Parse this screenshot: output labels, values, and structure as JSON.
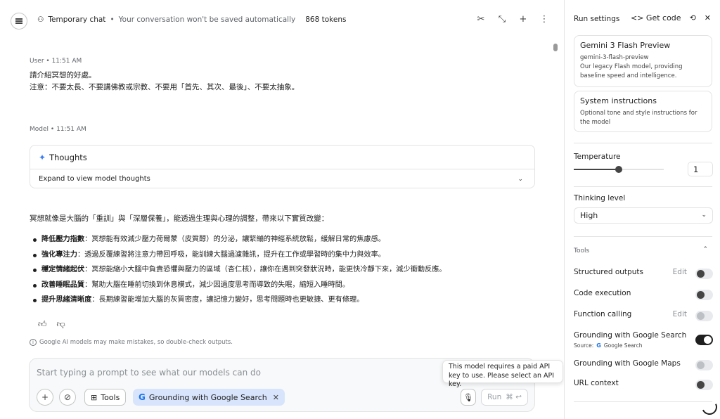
{
  "header": {
    "title": "Temporary chat",
    "subtitle": "Your conversation won't be saved automatically",
    "tokens": "868 tokens"
  },
  "user_msg": {
    "role": "User",
    "time": "11:51 AM",
    "line1": "請介紹冥想的好處。",
    "line2": "注意：不要太長、不要講佛教或宗教、不要用「首先、其次、最後」、不要太抽象。"
  },
  "model_msg": {
    "role": "Model",
    "time": "11:51 AM",
    "thoughts_title": "Thoughts",
    "thoughts_expand": "Expand to view model thoughts",
    "intro": "冥想就像是大腦的「重訓」與「深層保養」，能透過生理與心理的調整，帶來以下實質改變：",
    "items": [
      {
        "bold": "降低壓力指數",
        "text": "：冥想能有效減少壓力荷爾蒙（皮質醇）的分泌，讓緊繃的神經系統放鬆，緩解日常的焦慮感。"
      },
      {
        "bold": "強化專注力",
        "text": "：透過反覆練習將注意力帶回呼吸，能訓練大腦過濾雜訊，提升在工作或學習時的集中力與效率。"
      },
      {
        "bold": "穩定情緒起伏",
        "text": "：冥想能縮小大腦中負責恐懼與壓力的區域（杏仁核），讓你在遇到突發狀況時，能更快冷靜下來，減少衝動反應。"
      },
      {
        "bold": "改善睡眠品質",
        "text": "：幫助大腦在睡前切換到休息模式，減少因過度思考而導致的失眠，縮短入睡時間。"
      },
      {
        "bold": "提升思緒清晰度",
        "text": "：長期練習能增加大腦的灰質密度，讓記憶力變好，思考問題時也更敏捷、更有條理。"
      }
    ]
  },
  "disclaimer": "Google AI models may make mistakes, so double-check outputs.",
  "prompt": {
    "placeholder": "Start typing a prompt to see what our models can do",
    "tools_label": "Tools",
    "grounding_chip": "Grounding with Google Search",
    "run_label": "Run",
    "run_shortcut": "⌘ ↩"
  },
  "tooltip": "This model requires a paid API key to use. Please select an API key.",
  "panel": {
    "title": "Run settings",
    "get_code": "Get code",
    "model_name": "Gemini 3 Flash Preview",
    "model_id": "gemini-3-flash-preview",
    "model_desc": "Our legacy Flash model, providing baseline speed and intelligence.",
    "sys_title": "System instructions",
    "sys_desc": "Optional tone and style instructions for the model",
    "temperature_label": "Temperature",
    "temperature_value": "1",
    "temperature_fraction": 0.5,
    "thinking_label": "Thinking level",
    "thinking_value": "High",
    "tools_header": "Tools",
    "tools": [
      {
        "label": "Structured outputs",
        "edit": "Edit",
        "state": "off"
      },
      {
        "label": "Code execution",
        "edit": "",
        "state": "off"
      },
      {
        "label": "Function calling",
        "edit": "Edit",
        "state": "disabled"
      },
      {
        "label": "Grounding with Google Search",
        "edit": "",
        "state": "on"
      },
      {
        "label": "Grounding with Google Maps",
        "edit": "",
        "state": "disabled"
      },
      {
        "label": "URL context",
        "edit": "",
        "state": "off"
      }
    ],
    "source_label": "Source:",
    "source_value": "Google Search"
  },
  "colors": {
    "accent": "#1a73e8",
    "chip_bg": "#d7e4fb"
  }
}
